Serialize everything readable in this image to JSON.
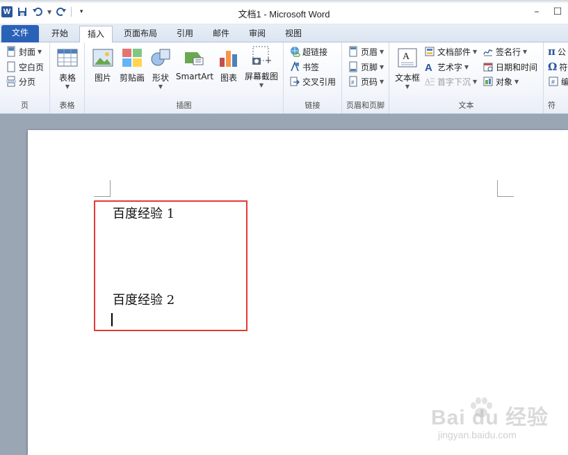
{
  "window": {
    "title": "文档1 - Microsoft Word",
    "controls": {
      "minimize": "–",
      "restore": "☐"
    }
  },
  "quick_access": {
    "icons": [
      "word-logo",
      "save-icon",
      "undo-icon",
      "redo-icon",
      "customize-icon"
    ],
    "logo_text": "W"
  },
  "tabs": [
    {
      "label": "文件",
      "type": "file"
    },
    {
      "label": "开始"
    },
    {
      "label": "插入",
      "active": true
    },
    {
      "label": "页面布局"
    },
    {
      "label": "引用"
    },
    {
      "label": "邮件"
    },
    {
      "label": "审阅"
    },
    {
      "label": "视图"
    }
  ],
  "ribbon": {
    "pages": {
      "label": "页",
      "cover": "封面",
      "blank": "空白页",
      "break": "分页"
    },
    "tables": {
      "label": "表格",
      "table": "表格"
    },
    "illustrations": {
      "label": "插图",
      "picture": "图片",
      "clipart": "剪贴画",
      "shapes": "形状",
      "smartart": "SmartArt",
      "chart": "图表",
      "screenshot": "屏幕截图"
    },
    "links": {
      "label": "链接",
      "hyperlink": "超链接",
      "bookmark": "书签",
      "crossref": "交叉引用"
    },
    "header_footer": {
      "label": "页眉和页脚",
      "header": "页眉",
      "footer": "页脚",
      "page_number": "页码"
    },
    "text": {
      "label": "文本",
      "textbox": "文本框",
      "quick_parts": "文档部件",
      "wordart": "艺术字",
      "dropcap": "首字下沉",
      "signature": "签名行",
      "datetime": "日期和时间",
      "object": "对象"
    },
    "symbols": {
      "label": "符",
      "equation": "公",
      "symbol": "符",
      "number": "编"
    }
  },
  "document": {
    "line1": "百度经验 1",
    "line2": "百度经验 2"
  },
  "watermark": {
    "main": "Bai du 经验",
    "sub": "jingyan.baidu.com"
  },
  "colors": {
    "file_tab": "#2a62b8",
    "highlight": "#e53935",
    "doc_background": "#9ba6b5"
  }
}
